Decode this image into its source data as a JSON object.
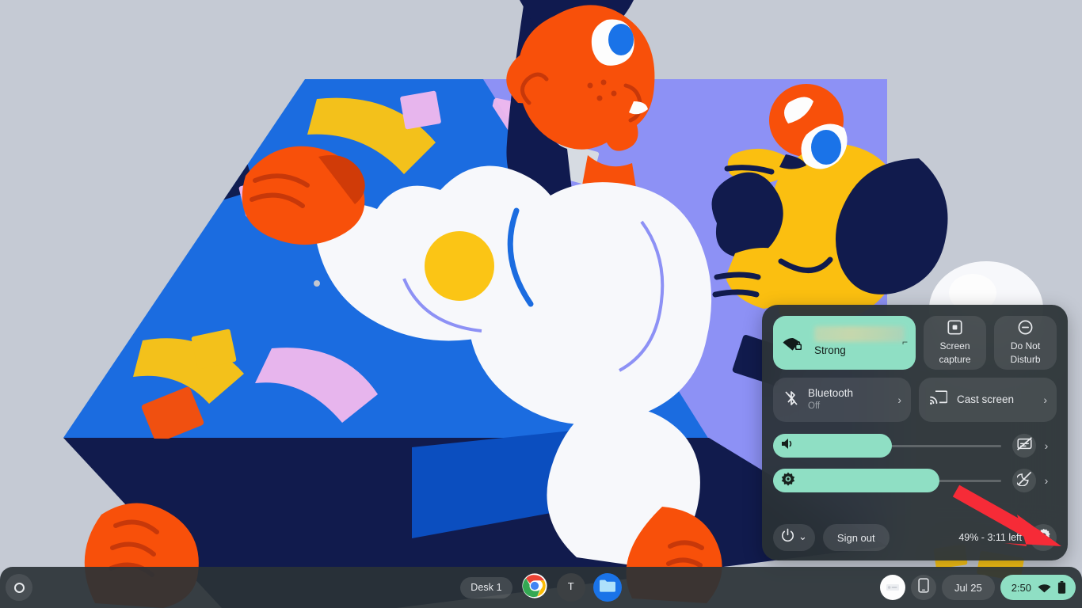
{
  "theme": {
    "accent_green": "#8fdfc4",
    "panel_bg": "rgba(41,48,52,0.93)",
    "shelf_bg": "rgba(42,50,54,0.92)",
    "text_primary": "#e8eaed",
    "text_secondary": "#9aa0a6",
    "annotation_red": "#f62b37",
    "wallpaper_bg": "#c5cad4"
  },
  "wallpaper": {
    "name": "chromeos-illustration-wallpaper",
    "palette": {
      "background": "#c5cad4",
      "box_top_blue": "#1b6ce0",
      "box_side_purple": "#8d91f5",
      "box_bottom_navy": "#111b4d",
      "skin_orange": "#f8500a",
      "hair_navy": "#101a4f",
      "shirt_white": "#f7f8fb",
      "dog_yellow": "#fbbf10",
      "accent_yellow": "#fbc515",
      "accent_pink": "#efb8ee",
      "accent_grey": "#d9dde2",
      "eye_blue": "#1a73e8"
    }
  },
  "shelf": {
    "launcher": {
      "name": "launcher-button",
      "icon": "circle-launcher-icon"
    },
    "desk_chip_label": "Desk 1",
    "apps": [
      {
        "name": "chrome",
        "label": "Chrome",
        "icon": "chrome-icon"
      },
      {
        "name": "terminal",
        "label": "Terminal",
        "icon": "terminal-icon",
        "glyph": "T"
      },
      {
        "name": "files",
        "label": "Files",
        "icon": "files-folder-icon"
      }
    ],
    "status": {
      "avatar_label": "Profile",
      "phone_hub_label": "Phone Hub",
      "date": "Jul 25",
      "time": "2:50",
      "wifi_icon": "wifi-icon",
      "battery_icon": "battery-icon"
    }
  },
  "quick_settings": {
    "network_tile": {
      "label_redacted": "",
      "status": "Strong",
      "icon": "wifi-locked-icon",
      "secure": true
    },
    "screen_capture_tile": {
      "label_line1": "Screen",
      "label_line2": "capture",
      "icon": "screen-capture-icon"
    },
    "do_not_disturb_tile": {
      "label_line1": "Do Not",
      "label_line2": "Disturb",
      "icon": "do-not-disturb-icon"
    },
    "bluetooth_tile": {
      "title": "Bluetooth",
      "subtitle": "Off",
      "icon": "bluetooth-disabled-icon",
      "chevron": "›"
    },
    "cast_tile": {
      "title": "Cast screen",
      "icon": "cast-icon",
      "chevron": "›"
    },
    "volume_slider": {
      "name": "volume",
      "icon": "volume-up-icon",
      "value_percent": 52,
      "end_icon": "live-caption-off-icon",
      "chevron": "›"
    },
    "brightness_slider": {
      "name": "brightness",
      "icon": "brightness-icon",
      "value_percent": 73,
      "end_icon": "night-light-off-icon",
      "chevron": "›"
    },
    "footer": {
      "power_icon": "power-icon",
      "power_chevron": "⌄",
      "sign_out_label": "Sign out",
      "battery_status": "49% - 3:11 left",
      "settings_icon": "gear-icon"
    }
  },
  "annotation": {
    "type": "arrow",
    "color": "#f62b37",
    "points_to": "settings-gear-button"
  }
}
